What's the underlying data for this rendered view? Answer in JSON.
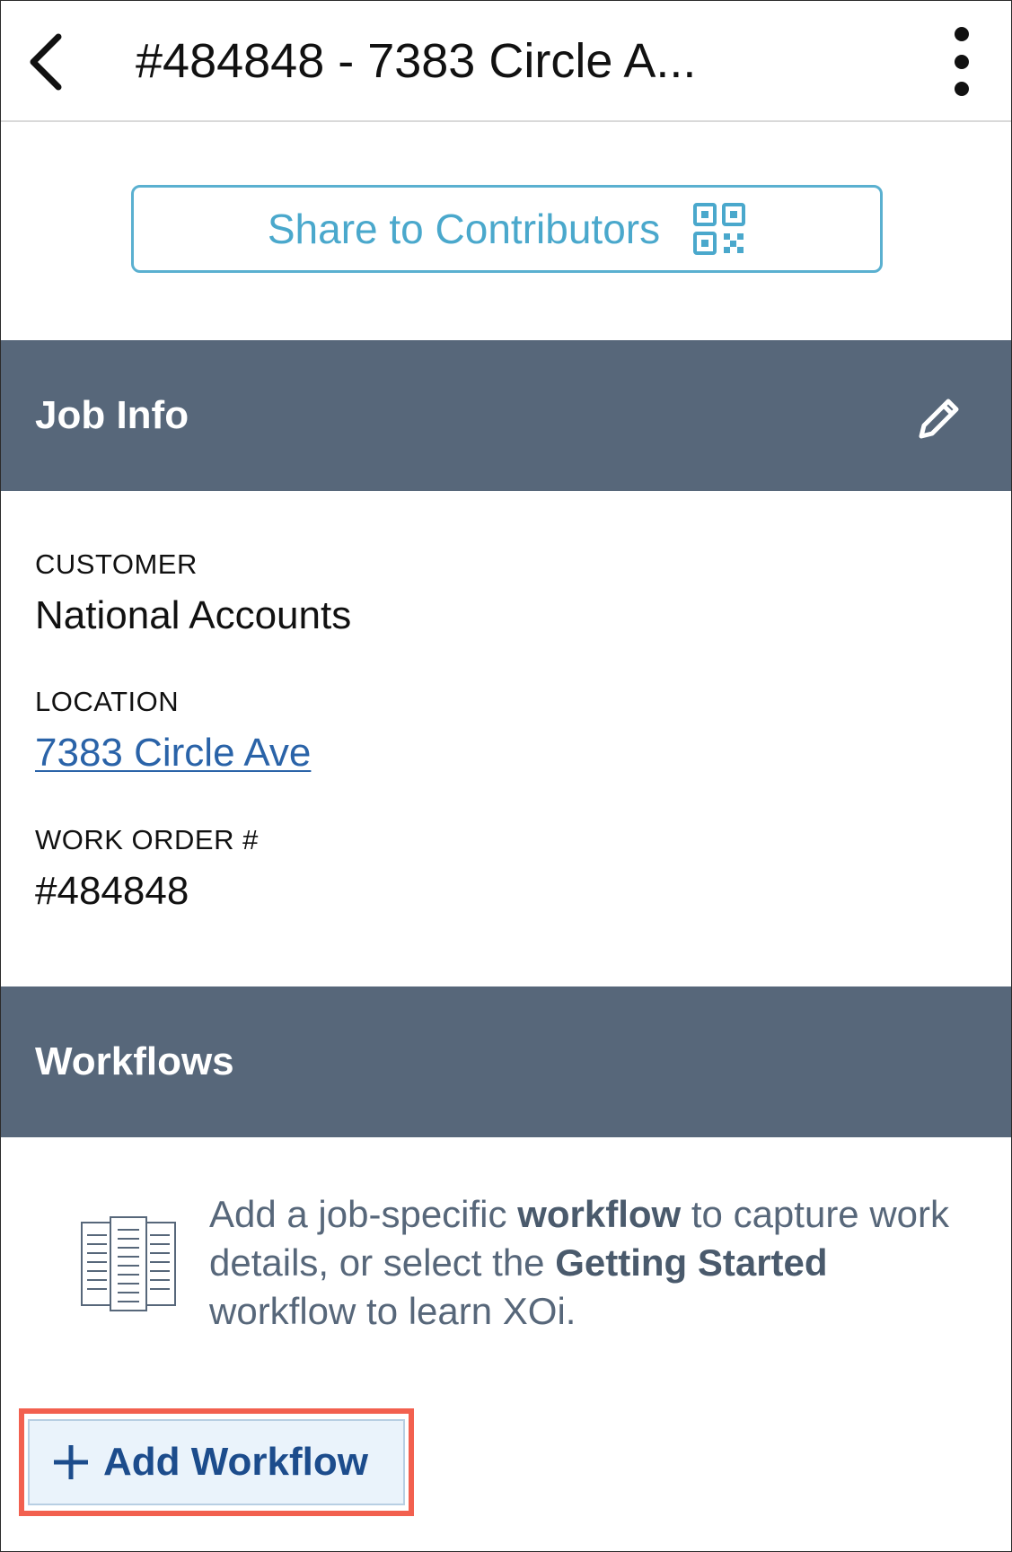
{
  "header": {
    "title": "#484848 - 7383 Circle A...",
    "back_icon": "chevron-left-icon",
    "more_icon": "more-vertical-icon"
  },
  "share": {
    "label": "Share to Contributors",
    "icon": "qr-code-icon",
    "color": "#4aa8cc"
  },
  "job_info": {
    "title": "Job Info",
    "edit_icon": "pencil-icon",
    "fields": [
      {
        "label": "CUSTOMER",
        "value": "National Accounts"
      },
      {
        "label": "LOCATION",
        "value": "7383 Circle Ave"
      },
      {
        "label": "WORK ORDER #",
        "value": "#484848"
      }
    ]
  },
  "workflows": {
    "title": "Workflows",
    "empty_icon": "documents-icon",
    "empty_text": {
      "part1": "Add a job-specific ",
      "bold1": "workflow",
      "part2": " to capture work details, or select the ",
      "bold2": "Getting Started",
      "part3": " workflow to learn XOi."
    },
    "add_button": {
      "label": "Add Workflow",
      "icon": "plus-icon"
    }
  },
  "colors": {
    "section_header": "#57677a",
    "link": "#2a63a8",
    "highlight": "#f2604f",
    "add_button_text": "#1c4c8c"
  }
}
